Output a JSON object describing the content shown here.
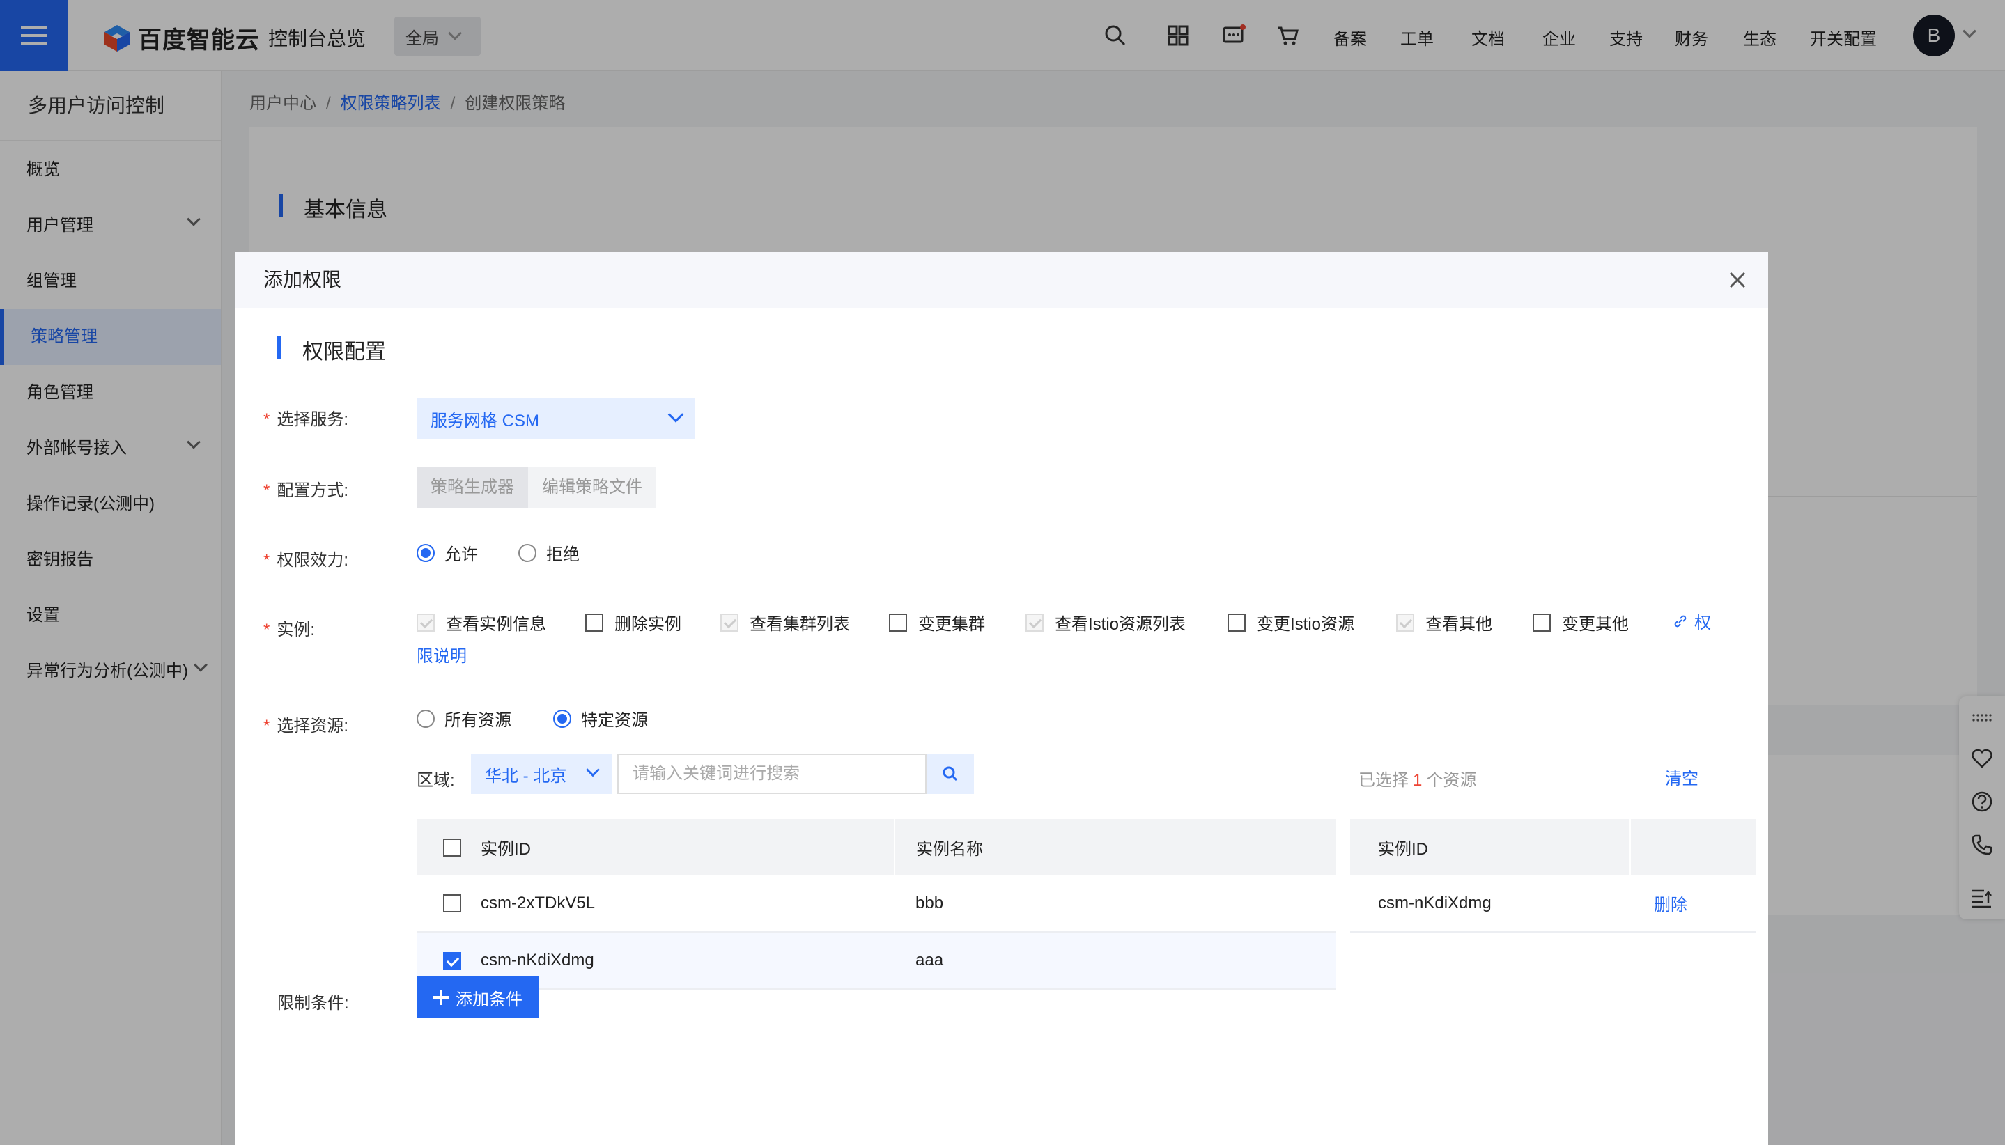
{
  "header": {
    "logo_text": "百度智能云",
    "console_title": "控制台总览",
    "scope": "全局",
    "links": [
      "备案",
      "工单",
      "文档",
      "企业",
      "支持",
      "财务",
      "生态",
      "开关配置"
    ],
    "avatar_letter": "B",
    "icons": [
      "search-icon",
      "grid-icon",
      "message-icon",
      "cart-icon"
    ]
  },
  "sidebar": {
    "title": "多用户访问控制",
    "items": [
      {
        "label": "概览"
      },
      {
        "label": "用户管理"
      },
      {
        "label": "组管理"
      },
      {
        "label": "策略管理"
      },
      {
        "label": "角色管理"
      },
      {
        "label": "外部帐号接入"
      },
      {
        "label": "操作记录(公测中)"
      },
      {
        "label": "密钥报告"
      },
      {
        "label": "设置"
      },
      {
        "label": "异常行为分析(公测中)"
      }
    ],
    "active": "策略管理"
  },
  "breadcrumb": {
    "home": "用户中心",
    "list": "权限策略列表",
    "current": "创建权限策略"
  },
  "page": {
    "section_title": "基本信息"
  },
  "dialog": {
    "title": "添加权限",
    "section_title": "权限配置",
    "labels": {
      "service": "选择服务:",
      "mode": "配置方式:",
      "effect": "权限效力:",
      "instance": "实例:",
      "resource": "选择资源:",
      "condition": "限制条件:"
    },
    "service_value": "服务网格 CSM",
    "mode_options": [
      "策略生成器",
      "编辑策略文件"
    ],
    "effect_options": [
      "允许",
      "拒绝"
    ],
    "instance_perms": [
      {
        "label": "查看实例信息",
        "state": "disabled-checked"
      },
      {
        "label": "删除实例",
        "state": "unchecked"
      },
      {
        "label": "查看集群列表",
        "state": "disabled-checked"
      },
      {
        "label": "变更集群",
        "state": "unchecked"
      },
      {
        "label": "查看Istio资源列表",
        "state": "disabled-checked"
      },
      {
        "label": "变更Istio资源",
        "state": "unchecked"
      },
      {
        "label": "查看其他",
        "state": "disabled-checked"
      },
      {
        "label": "变更其他",
        "state": "unchecked"
      }
    ],
    "perm_doc_link_part1": "权",
    "perm_doc_link_part2": "限说明",
    "resource_options": [
      "所有资源",
      "特定资源"
    ],
    "region_label": "区域:",
    "region_value": "华北 - 北京",
    "search_placeholder": "请输入关键词进行搜索",
    "selected_prefix": "已选择",
    "selected_count": "1",
    "selected_suffix": "个资源",
    "clear_label": "清空",
    "left_table": {
      "headers": [
        "实例ID",
        "实例名称"
      ],
      "rows": [
        {
          "id": "csm-2xTDkV5L",
          "name": "bbb",
          "checked": false
        },
        {
          "id": "csm-nKdiXdmg",
          "name": "aaa",
          "checked": true
        }
      ]
    },
    "right_table": {
      "header": "实例ID",
      "rows": [
        {
          "id": "csm-nKdiXdmg",
          "action": "删除"
        }
      ]
    },
    "add_condition_label": "添加条件"
  }
}
